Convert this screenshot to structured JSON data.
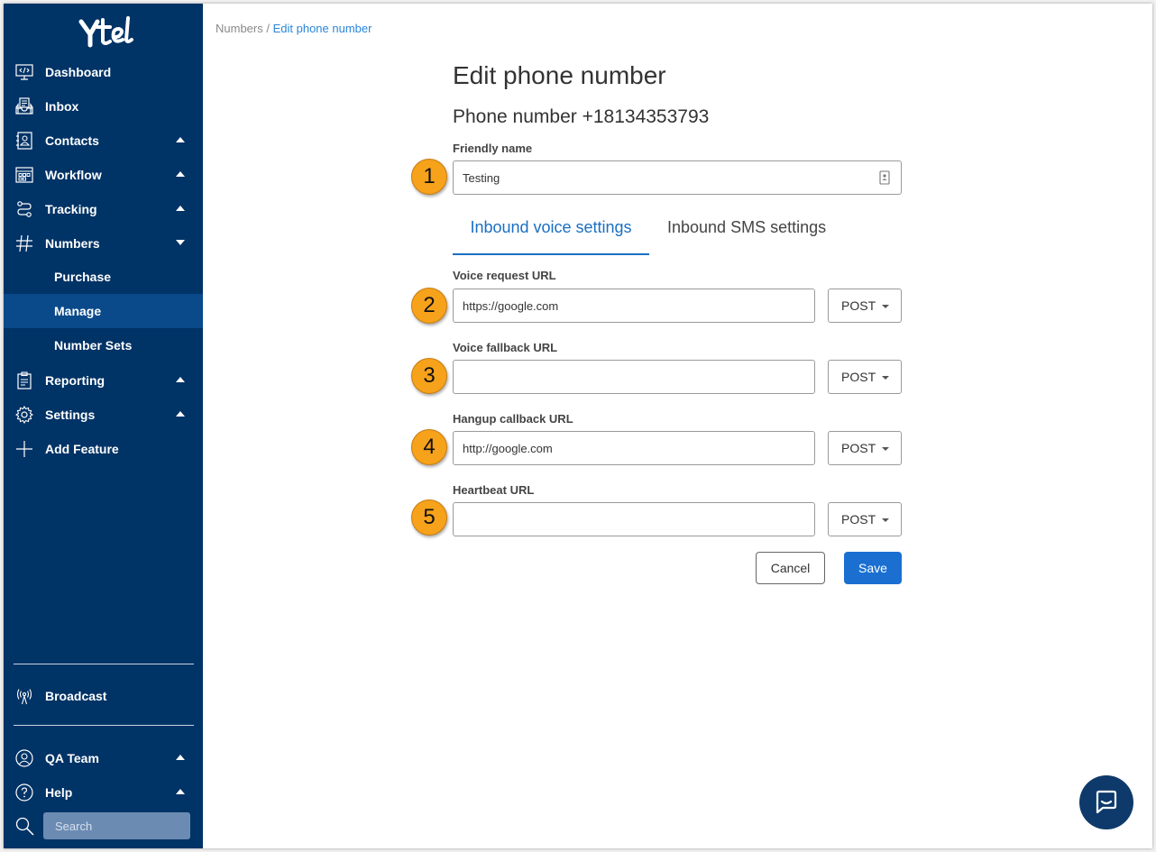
{
  "brand": {
    "logo_text": "Ytel"
  },
  "sidebar": {
    "items": [
      {
        "label": "Dashboard",
        "icon": "dashboard-icon"
      },
      {
        "label": "Inbox",
        "icon": "inbox-icon"
      },
      {
        "label": "Contacts",
        "icon": "contacts-icon"
      },
      {
        "label": "Workflow",
        "icon": "workflow-icon"
      },
      {
        "label": "Tracking",
        "icon": "tracking-icon"
      },
      {
        "label": "Numbers",
        "icon": "hash-icon"
      }
    ],
    "numbers_subitems": [
      {
        "label": "Purchase"
      },
      {
        "label": "Manage",
        "active": true
      },
      {
        "label": "Number Sets"
      }
    ],
    "items_lower": [
      {
        "label": "Reporting",
        "icon": "reporting-icon"
      },
      {
        "label": "Settings",
        "icon": "gear-icon"
      },
      {
        "label": "Add Feature",
        "icon": "plus-icon"
      }
    ],
    "broadcast": {
      "label": "Broadcast",
      "icon": "broadcast-icon"
    },
    "team": {
      "label": "QA Team",
      "icon": "user-icon"
    },
    "help": {
      "label": "Help",
      "icon": "help-icon"
    },
    "search": {
      "placeholder": "Search",
      "icon": "search-icon"
    }
  },
  "breadcrumb": {
    "parent": "Numbers",
    "separator": " / ",
    "current": "Edit phone number"
  },
  "page": {
    "title": "Edit phone number",
    "subtitle": "Phone number +18134353793"
  },
  "friendly_name": {
    "label": "Friendly name",
    "value": "Testing",
    "badge": "1"
  },
  "tabs": {
    "active": "Inbound voice settings",
    "inactive": "Inbound SMS settings"
  },
  "fields": {
    "voice_request": {
      "label": "Voice request URL",
      "value": "https://google.com",
      "method": "POST",
      "badge": "2"
    },
    "voice_fallback": {
      "label": "Voice fallback URL",
      "value": "",
      "method": "POST",
      "badge": "3"
    },
    "hangup_callback": {
      "label": "Hangup callback URL",
      "value": "http://google.com",
      "method": "POST",
      "badge": "4"
    },
    "heartbeat": {
      "label": "Heartbeat URL",
      "value": "",
      "method": "POST",
      "badge": "5"
    }
  },
  "actions": {
    "cancel": "Cancel",
    "save": "Save"
  },
  "colors": {
    "sidebar_bg": "#003366",
    "accent": "#1a6fd1",
    "badge": "#f7a21b",
    "active_nav": "#0a4a8a"
  }
}
